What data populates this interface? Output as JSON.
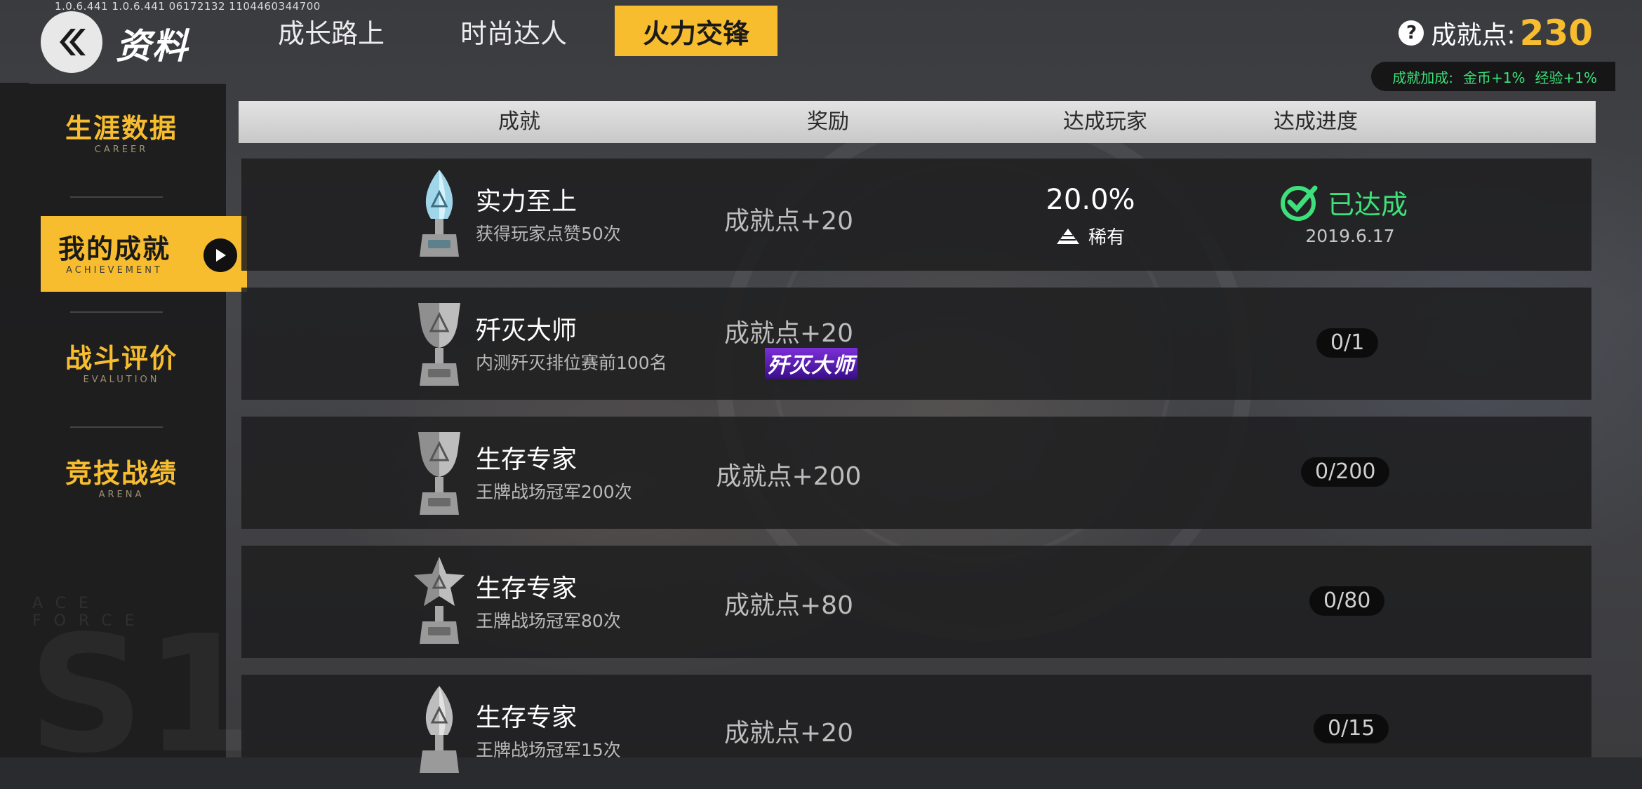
{
  "version": "1.0.6.441 1.0.6.441 06172132 1104460344700",
  "header": {
    "title": "资料",
    "tabs": [
      "成长路上",
      "时尚达人",
      "火力交锋"
    ],
    "active_tab": "火力交锋",
    "points_label": "成就点:",
    "points_value": "230",
    "bonus_label": "成就加成:",
    "bonus_gold": "金币+1%",
    "bonus_exp": "经验+1%"
  },
  "sidebar": {
    "items": [
      {
        "cn": "生涯数据",
        "en": "CAREER"
      },
      {
        "cn": "我的成就",
        "en": "ACHIEVEMENT"
      },
      {
        "cn": "战斗评价",
        "en": "EVALUTION"
      },
      {
        "cn": "竞技战绩",
        "en": "ARENA"
      }
    ],
    "active": "我的成就",
    "watermark_small": "ACE FORCE",
    "watermark_big": "S1"
  },
  "table": {
    "columns": [
      "成就",
      "奖励",
      "达成玩家",
      "达成进度"
    ],
    "rows": [
      {
        "trophy": "silver-blue-crystal",
        "title": "实力至上",
        "desc": "获得玩家点赞50次",
        "reward": "成就点+20",
        "percent": "20.0%",
        "rarity": "稀有",
        "status": "已达成",
        "date": "2019.6.17"
      },
      {
        "trophy": "silver-cup",
        "title": "歼灭大师",
        "desc": "内测歼灭排位赛前100名",
        "reward": "成就点+20",
        "reward_badge": "歼灭大师",
        "progress": "0/1"
      },
      {
        "trophy": "silver-cup",
        "title": "生存专家",
        "desc": "王牌战场冠军200次",
        "reward": "成就点+200",
        "progress": "0/200"
      },
      {
        "trophy": "silver-star",
        "title": "生存专家",
        "desc": "王牌战场冠军80次",
        "reward": "成就点+80",
        "progress": "0/80"
      },
      {
        "trophy": "silver-crystal",
        "title": "生存专家",
        "desc": "王牌战场冠军15次",
        "reward": "成就点+20",
        "progress": "0/15"
      }
    ]
  },
  "colors": {
    "accent": "#f7bd2f",
    "success": "#3de07a",
    "badge_purple": "#7c2fd8"
  }
}
